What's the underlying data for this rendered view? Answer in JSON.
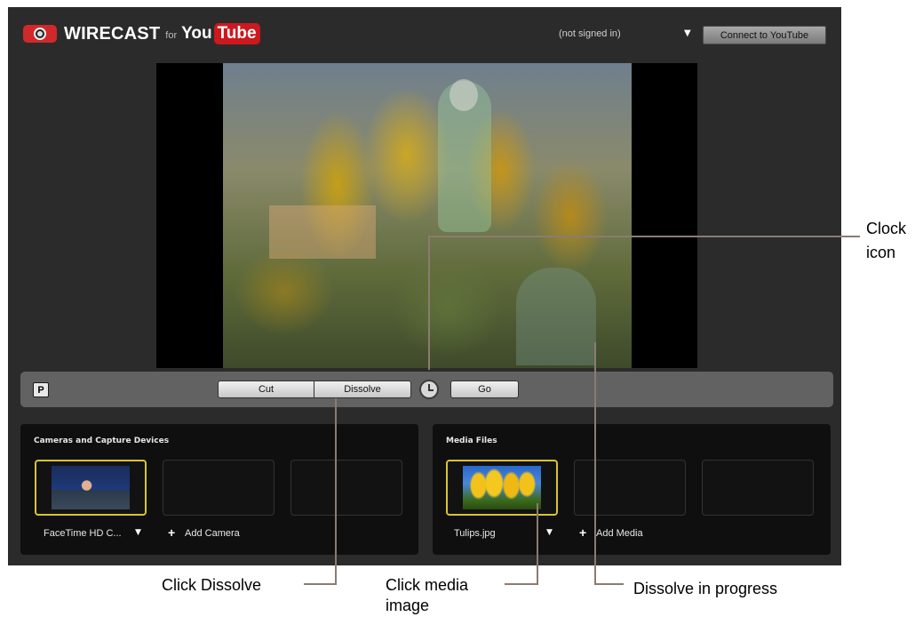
{
  "header": {
    "brand": "WIRECAST",
    "for_text": "for",
    "youtube_you": "You",
    "youtube_tube": "Tube",
    "signin_status": "(not signed in)",
    "dropdown_caret": "▼",
    "connect_label": "Connect to YouTube"
  },
  "controls": {
    "p_label": "P",
    "cut_label": "Cut",
    "dissolve_label": "Dissolve",
    "go_label": "Go",
    "clock_icon": "clock-icon"
  },
  "cameras": {
    "title": "Cameras and Capture Devices",
    "source_label": "FaceTime HD C...",
    "caret": "▼",
    "add_label": "Add Camera",
    "plus": "+"
  },
  "media": {
    "title": "Media Files",
    "source_label": "Tulips.jpg",
    "caret": "▼",
    "add_label": "Add Media",
    "plus": "+"
  },
  "annotations": {
    "clock_line1": "Clock",
    "clock_line2": "icon",
    "click_dissolve": "Click Dissolve",
    "click_media_line1": "Click media",
    "click_media_line2": "image",
    "dissolve_progress": "Dissolve in progress"
  },
  "colors": {
    "app_bg": "#2b2b2b",
    "accent_yellow": "#d8c431",
    "youtube_red": "#cc181e",
    "annotation_line": "#8c7b70"
  }
}
